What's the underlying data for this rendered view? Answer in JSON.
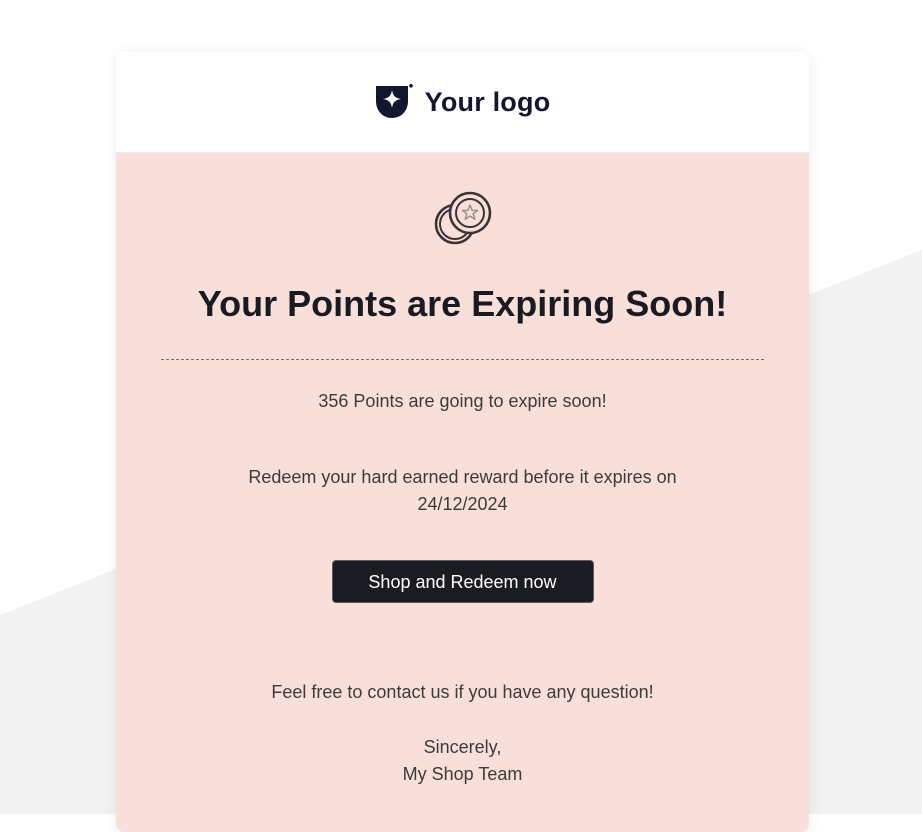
{
  "email": {
    "logo_text": "Your logo",
    "logo_icon": "shield-sparkle-icon",
    "hero_icon": "coins-star-icon",
    "title": "Your Points are Expiring Soon!",
    "points_message": "356 Points are going to expire soon!",
    "redeem_message_line1": "Redeem your hard earned reward before it expires on",
    "expiry_date": "24/12/2024",
    "cta_label": "Shop and Redeem now",
    "contact_message": "Feel free to contact us if you have any question!",
    "sign_off": "Sincerely,",
    "signature": "My Shop Team"
  },
  "colors": {
    "page_background": "#ffffff",
    "background_shape": "#f2f2f2",
    "header_background": "#ffffff",
    "content_background": "#f9dfda",
    "title_text": "#1a1a22",
    "body_text": "#3d3a3a",
    "logo_text": "#12172f",
    "button_background": "#1b1c22",
    "button_text": "#ffffff"
  }
}
